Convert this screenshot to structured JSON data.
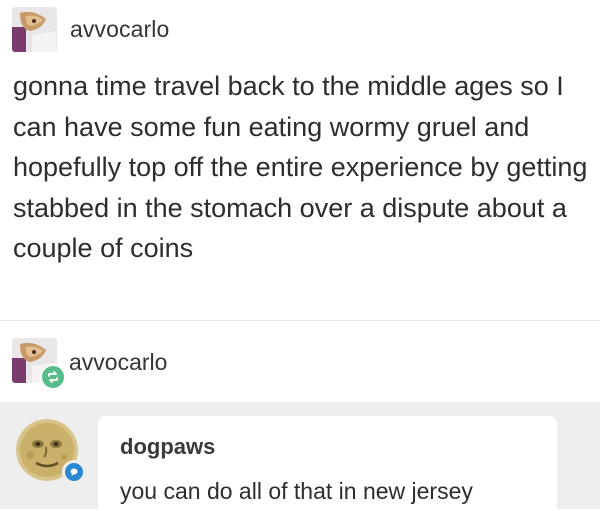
{
  "post": {
    "username": "avvocarlo",
    "avatar_icon": "blog-avatar-icon",
    "body": "gonna time travel back to the middle ages so I can have some fun eating wormy gruel and hopefully top off the entire experience by getting stabbed in the stomach over a dispute about a couple of coins"
  },
  "reblog": {
    "username": "avvocarlo",
    "avatar_icon": "blog-avatar-icon",
    "badge_icon": "reblog-icon",
    "badge_color": "#56bc8a"
  },
  "reply": {
    "username": "dogpaws",
    "text": "you can do all of that in new jersey",
    "avatar_icon": "moon-face-avatar-icon",
    "badge_icon": "reply-bubble-icon",
    "badge_color": "#2a87d4"
  }
}
